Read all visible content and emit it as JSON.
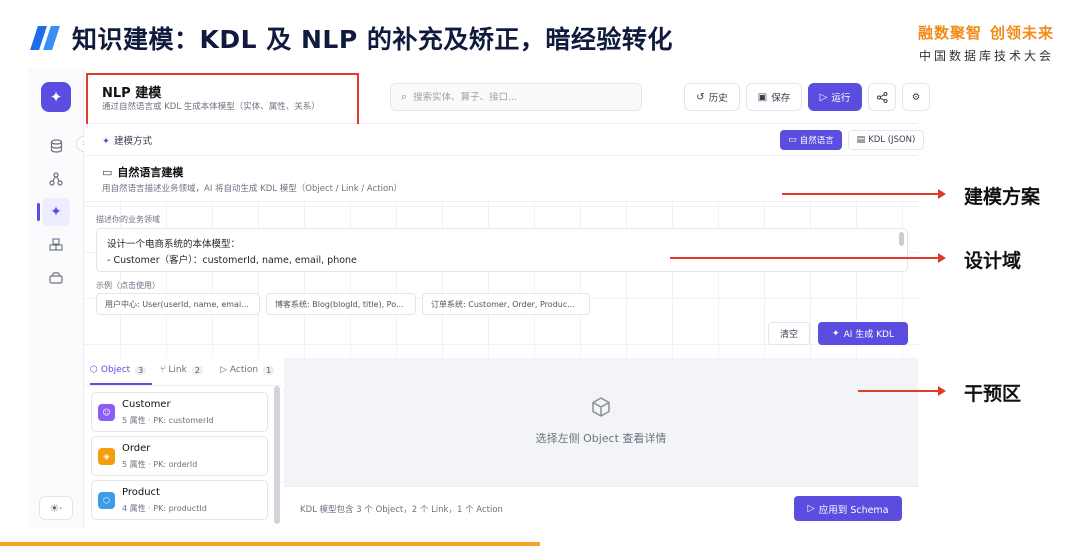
{
  "slide": {
    "title": "知识建模：KDL 及 NLP 的补充及矫正，暗经验转化",
    "brand_slogan_1": "融数聚智",
    "brand_slogan_2": "创领未来",
    "brand_sub": "中国数据库技术大会"
  },
  "colors": {
    "accent": "#5b4de0",
    "highlight": "#e23a2b",
    "title_mark": "#1e6de8",
    "brand": "#f28c18"
  },
  "icons": {
    "logo": "sparkle-icon",
    "rail": [
      "database-icon",
      "graph-icon",
      "sparkle-icon",
      "cubes-icon",
      "drive-icon"
    ],
    "theme": "sun-icon"
  },
  "header": {
    "title": "NLP 建模",
    "description": "通过自然语言或 KDL 生成本体模型（实体、属性、关系）",
    "search_placeholder": "搜索实体、算子、接口...",
    "history_label": "历史",
    "save_label": "保存",
    "run_label": "运行"
  },
  "mode": {
    "label": "建模方式",
    "tabs": [
      {
        "label": "自然语言",
        "active": true
      },
      {
        "label": "KDL (JSON)",
        "active": false
      }
    ]
  },
  "nl": {
    "title": "自然语言建模",
    "description": "用自然语言描述业务领域，AI 将自动生成 KDL 模型（Object / Link / Action）",
    "domain_label": "描述你的业务领域",
    "domain_lines": [
      "设计一个电商系统的本体模型：",
      "- Customer（客户）：customerId, name, email, phone"
    ],
    "examples_label": "示例（点击使用）",
    "examples": [
      "用户中心: User(userId, name, emai...",
      "博客系统: Blog(blogId, title), Po...",
      "订单系统: Customer, Order, Produc..."
    ],
    "clear_label": "清空",
    "generate_label": "AI 生成 KDL"
  },
  "object_tabs": [
    {
      "label": "Object",
      "count": "3",
      "active": true
    },
    {
      "label": "Link",
      "count": "2",
      "active": false
    },
    {
      "label": "Action",
      "count": "1",
      "active": false
    }
  ],
  "objects": [
    {
      "name": "Customer",
      "meta": "5 属性 · PK: customerId",
      "color": "#8b5cf6",
      "icon": "user-icon"
    },
    {
      "name": "Order",
      "meta": "5 属性 · PK: orderId",
      "color": "#f59e0b",
      "icon": "tag-icon"
    },
    {
      "name": "Product",
      "meta": "4 属性 · PK: productId",
      "color": "#3b9be8",
      "icon": "box-icon"
    }
  ],
  "detail": {
    "empty_text": "选择左侧 Object 查看详情"
  },
  "footer": {
    "summary": "KDL 模型包含 3 个 Object，2 个 Link，1 个 Action",
    "apply_label": "应用到 Schema"
  },
  "annotations": [
    "建模方案",
    "设计域",
    "干预区"
  ]
}
